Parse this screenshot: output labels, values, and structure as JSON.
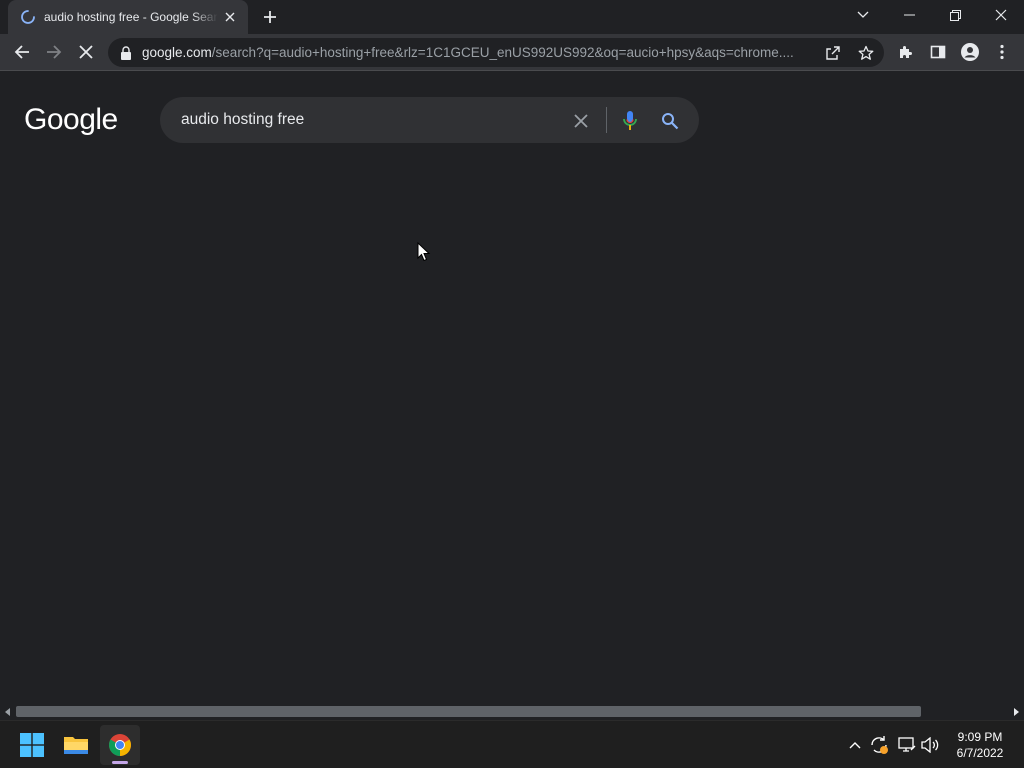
{
  "browser": {
    "tab": {
      "title": "audio hosting free - Google Search",
      "state": "loading"
    },
    "url": {
      "host": "google.com",
      "path": "/search?q=audio+hosting+free&rlz=1C1GCEU_enUS992US992&oq=aucio+hpsy&aqs=chrome...."
    }
  },
  "google": {
    "logo": "Google",
    "search_query": "audio hosting free"
  },
  "taskbar": {
    "apps": [
      "windows-start",
      "file-explorer",
      "chrome"
    ],
    "clock": {
      "time": "9:09 PM",
      "date": "6/7/2022"
    }
  },
  "colors": {
    "page_bg": "#202124",
    "toolbar_bg": "#35363a",
    "searchbox_bg": "#303134",
    "text": "#e8eaed",
    "muted": "#9aa0a6"
  }
}
